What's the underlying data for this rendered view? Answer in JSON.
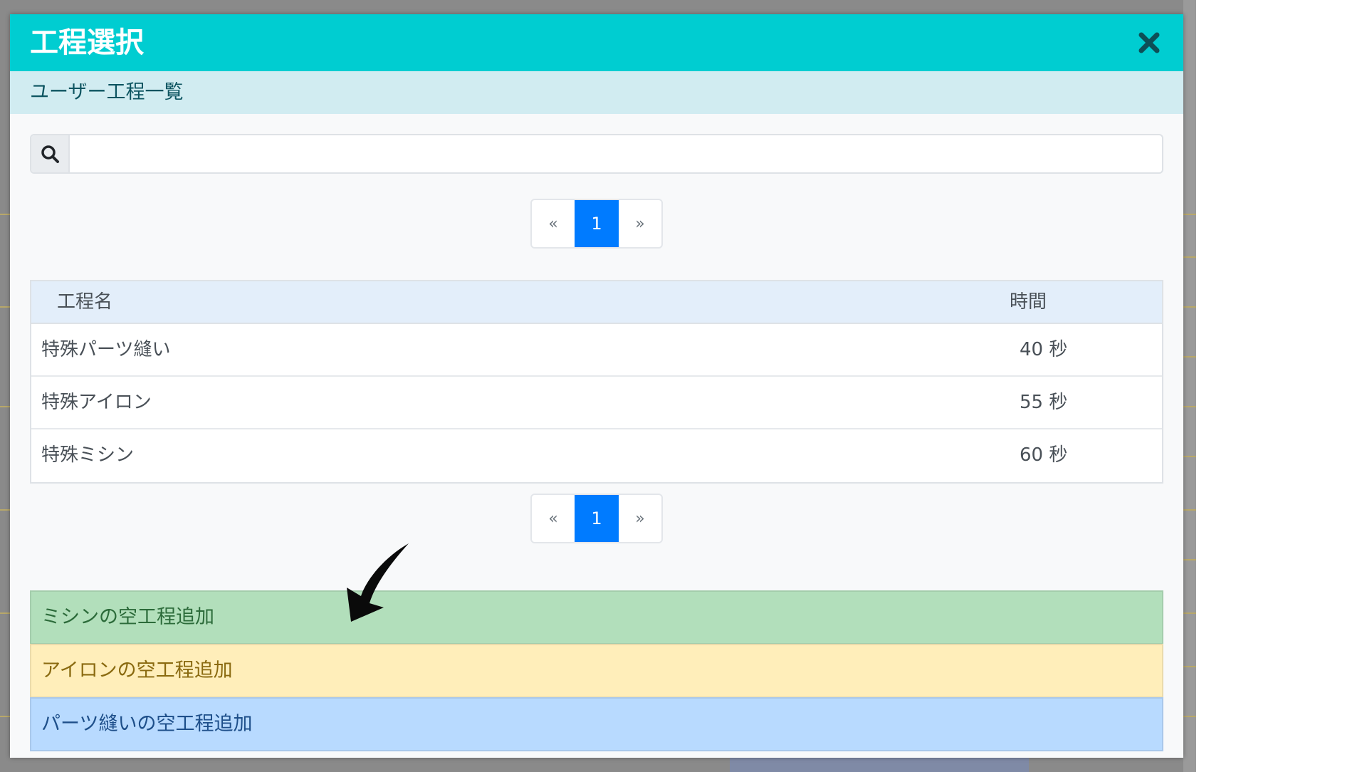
{
  "modal": {
    "title": "工程選択",
    "subheader": "ユーザー工程一覧"
  },
  "search": {
    "placeholder": "",
    "value": ""
  },
  "pagination": {
    "prev": "«",
    "current": "1",
    "next": "»"
  },
  "table": {
    "headers": [
      "工程名",
      "時間"
    ],
    "rows": [
      {
        "name": "特殊パーツ縫い",
        "time": "40 秒"
      },
      {
        "name": "特殊アイロン",
        "time": "55 秒"
      },
      {
        "name": "特殊ミシン",
        "time": "60 秒"
      }
    ]
  },
  "actions": {
    "add_sewing": "ミシンの空工程追加",
    "add_iron": "アイロンの空工程追加",
    "add_parts": "パーツ縫いの空工程追加"
  },
  "icons": {
    "close": "close-icon",
    "search": "search-icon",
    "arrow": "curved-arrow-icon"
  },
  "colors": {
    "header": "#00cdd1",
    "subheader": "#d1ecf1",
    "page_active": "#007bff",
    "add_sewing": "#b2dfbb",
    "add_iron": "#ffeeba",
    "add_parts": "#b8daff"
  }
}
